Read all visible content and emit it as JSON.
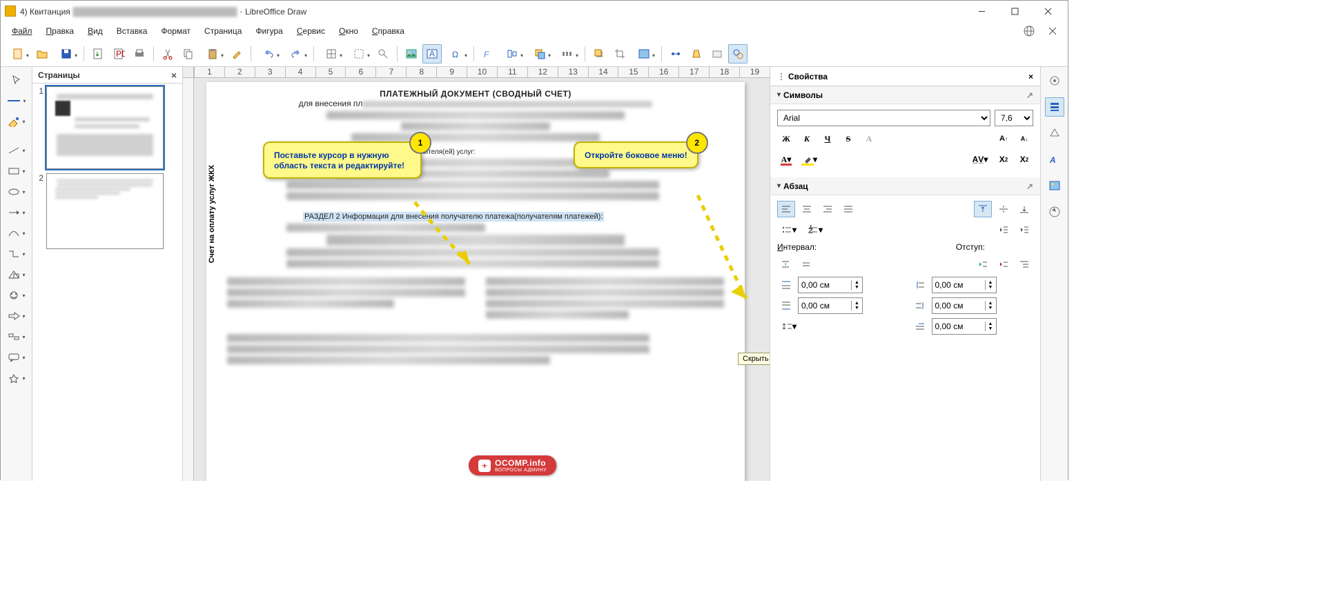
{
  "window": {
    "doc_prefix": "4) Квитанция",
    "app": "LibreOffice Draw"
  },
  "menu": {
    "file": "Файл",
    "edit": "Правка",
    "view": "Вид",
    "insert": "Вставка",
    "format": "Формат",
    "page": "Страница",
    "shape": "Фигура",
    "service": "Сервис",
    "window": "Окно",
    "help": "Справка"
  },
  "pages_panel": {
    "title": "Страницы",
    "p1": "1",
    "p2": "2"
  },
  "properties": {
    "title": "Свойства"
  },
  "symbols": {
    "title": "Символы",
    "font": "Arial",
    "size": "7,6"
  },
  "paragraph": {
    "title": "Абзац",
    "interval_label": "Интервал:",
    "indent_label": "Отступ:",
    "spacing_above": "0,00 см",
    "spacing_below": "0,00 см",
    "indent_before": "0,00 см",
    "indent_after": "0,00 см",
    "indent_first": "0,00 см"
  },
  "tooltip": {
    "hide": "Скрыть"
  },
  "callouts": {
    "c1_num": "1",
    "c1_text": "Поставьте курсор в нужную область текста и редактируйте!",
    "c2_num": "2",
    "c2_text": "Откройте боковое меню!"
  },
  "doc": {
    "vertical_label": "Счет на оплату услуг ЖКХ",
    "title_top": "ПЛАТЕЖНЫЙ ДОКУМЕНТ (СВОДНЫЙ СЧЕТ)",
    "subtitle": "для внесения пл",
    "line_executors": "нителя(ей) услуг:",
    "selected": "РАЗДЕЛ  2 Информация для внесения получателю платежа(получателям платежей):"
  },
  "watermark": {
    "text": "OCOMP.info",
    "sub": "ВОПРОСЫ АДМИНУ"
  },
  "ruler": [
    "1",
    "2",
    "3",
    "4",
    "5",
    "6",
    "7",
    "8",
    "9",
    "10",
    "11",
    "12",
    "13",
    "14",
    "15",
    "16",
    "17",
    "18",
    "19"
  ]
}
